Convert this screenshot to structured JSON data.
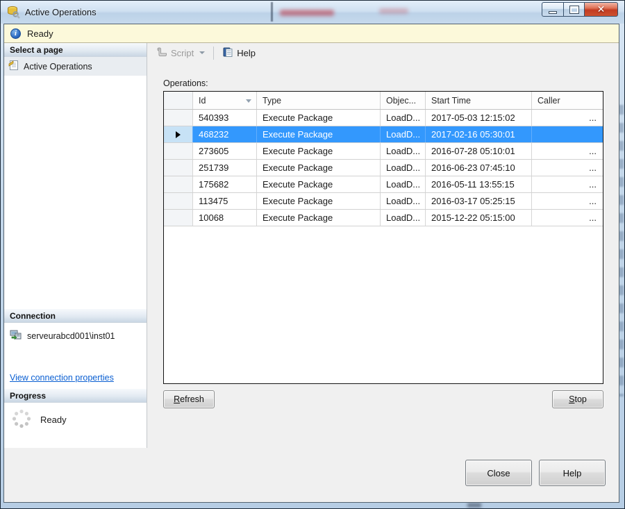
{
  "window": {
    "title": "Active Operations"
  },
  "status_bar": {
    "status": "Ready"
  },
  "toolbar": {
    "script": "Script",
    "help": "Help"
  },
  "sidebar": {
    "select_page_header": "Select a page",
    "page_item": "Active Operations",
    "connection_header": "Connection",
    "connection_name": "serveurabcd001\\inst01",
    "connection_link": "View connection properties",
    "progress_header": "Progress",
    "progress_status": "Ready"
  },
  "main": {
    "operations_label": "Operations:",
    "table": {
      "columns": {
        "id": "Id",
        "type": "Type",
        "object": "Objec...",
        "start_time": "Start Time",
        "caller": "Caller"
      },
      "rows": [
        {
          "id": "540393",
          "type": "Execute Package",
          "object": "LoadD...",
          "start_time": "2017-05-03 12:15:02",
          "caller": "...",
          "selected": false
        },
        {
          "id": "468232",
          "type": "Execute Package",
          "object": "LoadD...",
          "start_time": "2017-02-16 05:30:01",
          "caller": "",
          "selected": true
        },
        {
          "id": "273605",
          "type": "Execute Package",
          "object": "LoadD...",
          "start_time": "2016-07-28 05:10:01",
          "caller": "...",
          "selected": false
        },
        {
          "id": "251739",
          "type": "Execute Package",
          "object": "LoadD...",
          "start_time": "2016-06-23 07:45:10",
          "caller": "...",
          "selected": false
        },
        {
          "id": "175682",
          "type": "Execute Package",
          "object": "LoadD...",
          "start_time": "2016-05-11 13:55:15",
          "caller": "...",
          "selected": false
        },
        {
          "id": "113475",
          "type": "Execute Package",
          "object": "LoadD...",
          "start_time": "2016-03-17 05:25:15",
          "caller": "...",
          "selected": false
        },
        {
          "id": "10068",
          "type": "Execute Package",
          "object": "LoadD...",
          "start_time": "2015-12-22 05:15:00",
          "caller": "...",
          "selected": false
        }
      ]
    },
    "refresh_button": "Refresh",
    "stop_button": "Stop"
  },
  "footer": {
    "close_button": "Close",
    "help_button": "Help"
  },
  "colors": {
    "selection_blue": "#3398fd",
    "link_blue": "#0a5fd2",
    "status_bar_yellow": "#fcf9da",
    "titlebar_blue": "#cfe0f1",
    "close_button_red": "#c23c22"
  }
}
